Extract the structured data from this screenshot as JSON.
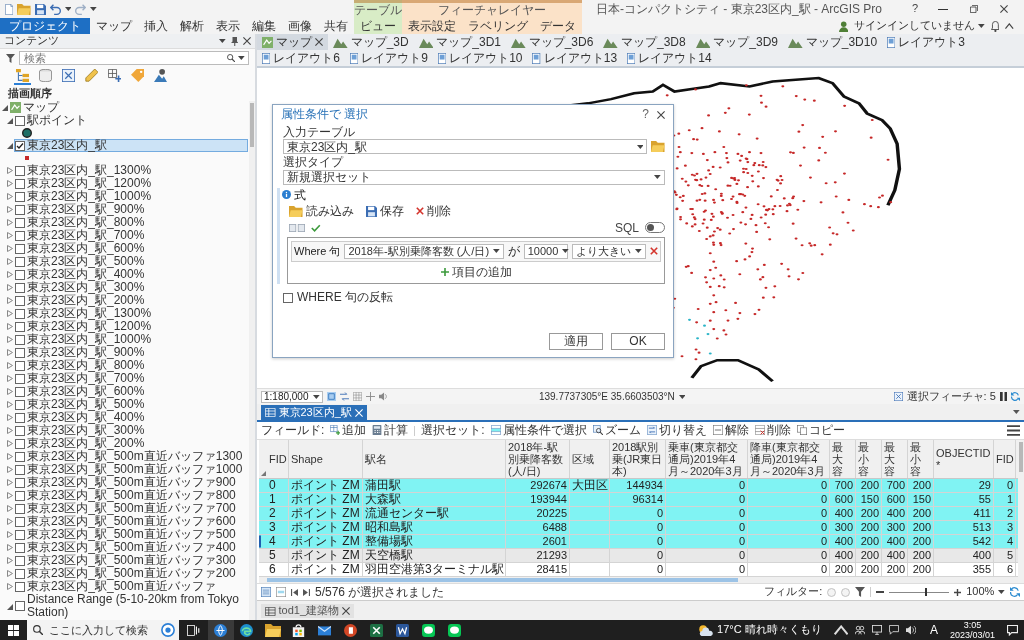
{
  "window": {
    "title": "日本-コンパクトシティ - 東京23区内_駅 - ArcGIS Pro",
    "help": "?"
  },
  "ribbon": {
    "tabs": [
      {
        "label": "プロジェクト",
        "kind": "backstage"
      },
      {
        "label": "マップ",
        "kind": "tab"
      },
      {
        "label": "挿入",
        "kind": "tab"
      },
      {
        "label": "解析",
        "kind": "tab"
      },
      {
        "label": "表示",
        "kind": "tab"
      },
      {
        "label": "編集",
        "kind": "tab"
      },
      {
        "label": "画像",
        "kind": "tab"
      },
      {
        "label": "共有",
        "kind": "tab"
      }
    ],
    "context_groups": [
      {
        "title": "テーブル",
        "color": "#d8ecc6",
        "tabs": [
          {
            "label": "ビュー"
          }
        ]
      },
      {
        "title": "フィーチャレイヤー",
        "color": "#fbe2c8",
        "tabs": [
          {
            "label": "表示設定"
          },
          {
            "label": "ラベリング"
          },
          {
            "label": "データ"
          }
        ]
      }
    ],
    "account": "サインインしていません"
  },
  "contents_pane": {
    "title": "コンテンツ",
    "search": {
      "placeholder": "検索"
    },
    "views": [
      {
        "kind": "drawing-order",
        "selected": true
      },
      {
        "kind": "source",
        "selected": false
      },
      {
        "kind": "selection",
        "selected": false
      },
      {
        "kind": "editing",
        "selected": false
      },
      {
        "kind": "snapping",
        "selected": false
      },
      {
        "kind": "labeling",
        "selected": false
      },
      {
        "kind": "imagery",
        "selected": false
      }
    ],
    "heading": "描画順序",
    "tree": [
      {
        "label": "マップ",
        "kind": "map",
        "expanded": true,
        "selected": false,
        "children": [
          {
            "label": "駅ポイント",
            "kind": "layer",
            "checked": false,
            "expanded": true,
            "selected": false,
            "children": [
              {
                "kind": "circle",
                "color": "#1f6f66"
              }
            ]
          },
          {
            "label": "東京23区内_駅",
            "kind": "layer",
            "checked": true,
            "expanded": true,
            "selected": true,
            "children": [
              {
                "kind": "dot",
                "color": "#c62828"
              }
            ]
          },
          {
            "label": "東京23区内_駅_1300%",
            "kind": "layer",
            "checked": false,
            "expanded": false,
            "selected": false
          },
          {
            "label": "東京23区内_駅_1200%",
            "kind": "layer",
            "checked": false,
            "expanded": false,
            "selected": false
          },
          {
            "label": "東京23区内_駅_1000%",
            "kind": "layer",
            "checked": false,
            "expanded": false,
            "selected": false
          },
          {
            "label": "東京23区内_駅_900%",
            "kind": "layer",
            "checked": false,
            "expanded": false,
            "selected": false
          },
          {
            "label": "東京23区内_駅_800%",
            "kind": "layer",
            "checked": false,
            "expanded": false,
            "selected": false
          },
          {
            "label": "東京23区内_駅_700%",
            "kind": "layer",
            "checked": false,
            "expanded": false,
            "selected": false
          },
          {
            "label": "東京23区内_駅_600%",
            "kind": "layer",
            "checked": false,
            "expanded": false,
            "selected": false
          },
          {
            "label": "東京23区内_駅_500%",
            "kind": "layer",
            "checked": false,
            "expanded": false,
            "selected": false
          },
          {
            "label": "東京23区内_駅_400%",
            "kind": "layer",
            "checked": false,
            "expanded": false,
            "selected": false
          },
          {
            "label": "東京23区内_駅_300%",
            "kind": "layer",
            "checked": false,
            "expanded": false,
            "selected": false
          },
          {
            "label": "東京23区内_駅_200%",
            "kind": "layer",
            "checked": false,
            "expanded": false,
            "selected": false
          },
          {
            "label": "東京23区内_駅_1300%",
            "kind": "layer",
            "checked": false,
            "expanded": false,
            "selected": false
          },
          {
            "label": "東京23区内_駅_1200%",
            "kind": "layer",
            "checked": false,
            "expanded": false,
            "selected": false
          },
          {
            "label": "東京23区内_駅_1000%",
            "kind": "layer",
            "checked": false,
            "expanded": false,
            "selected": false
          },
          {
            "label": "東京23区内_駅_900%",
            "kind": "layer",
            "checked": false,
            "expanded": false,
            "selected": false
          },
          {
            "label": "東京23区内_駅_800%",
            "kind": "layer",
            "checked": false,
            "expanded": false,
            "selected": false
          },
          {
            "label": "東京23区内_駅_700%",
            "kind": "layer",
            "checked": false,
            "expanded": false,
            "selected": false
          },
          {
            "label": "東京23区内_駅_600%",
            "kind": "layer",
            "checked": false,
            "expanded": false,
            "selected": false
          },
          {
            "label": "東京23区内_駅_500%",
            "kind": "layer",
            "checked": false,
            "expanded": false,
            "selected": false
          },
          {
            "label": "東京23区内_駅_400%",
            "kind": "layer",
            "checked": false,
            "expanded": false,
            "selected": false
          },
          {
            "label": "東京23区内_駅_300%",
            "kind": "layer",
            "checked": false,
            "expanded": false,
            "selected": false
          },
          {
            "label": "東京23区内_駅_200%",
            "kind": "layer",
            "checked": false,
            "expanded": false,
            "selected": false
          },
          {
            "label": "東京23区内_駅_500m直近バッファ1300",
            "kind": "layer",
            "checked": false,
            "expanded": false,
            "selected": false
          },
          {
            "label": "東京23区内_駅_500m直近バッファ1000",
            "kind": "layer",
            "checked": false,
            "expanded": false,
            "selected": false
          },
          {
            "label": "東京23区内_駅_500m直近バッファ900",
            "kind": "layer",
            "checked": false,
            "expanded": false,
            "selected": false
          },
          {
            "label": "東京23区内_駅_500m直近バッファ800",
            "kind": "layer",
            "checked": false,
            "expanded": false,
            "selected": false
          },
          {
            "label": "東京23区内_駅_500m直近バッファ700",
            "kind": "layer",
            "checked": false,
            "expanded": false,
            "selected": false
          },
          {
            "label": "東京23区内_駅_500m直近バッファ600",
            "kind": "layer",
            "checked": false,
            "expanded": false,
            "selected": false
          },
          {
            "label": "東京23区内_駅_500m直近バッファ500",
            "kind": "layer",
            "checked": false,
            "expanded": false,
            "selected": false
          },
          {
            "label": "東京23区内_駅_500m直近バッファ400",
            "kind": "layer",
            "checked": false,
            "expanded": false,
            "selected": false
          },
          {
            "label": "東京23区内_駅_500m直近バッファ300",
            "kind": "layer",
            "checked": false,
            "expanded": false,
            "selected": false
          },
          {
            "label": "東京23区内_駅_500m直近バッファ200",
            "kind": "layer",
            "checked": false,
            "expanded": false,
            "selected": false
          },
          {
            "label": "東京23区内_駅_500m直近バッファ",
            "kind": "layer",
            "checked": false,
            "expanded": false,
            "selected": false
          },
          {
            "label": "Distance Range (5-10-20km from Tokyo Station)",
            "kind": "layer",
            "checked": false,
            "expanded": true,
            "selected": false
          }
        ]
      }
    ]
  },
  "map_tabs": [
    {
      "label": "マップ",
      "kind": "map",
      "selected": true
    },
    {
      "label": "マップ_3D",
      "kind": "scene",
      "selected": false
    },
    {
      "label": "マップ_3D1",
      "kind": "scene",
      "selected": false
    },
    {
      "label": "マップ_3D6",
      "kind": "scene",
      "selected": false
    },
    {
      "label": "マップ_3D8",
      "kind": "scene",
      "selected": false
    },
    {
      "label": "マップ_3D9",
      "kind": "scene",
      "selected": false
    },
    {
      "label": "マップ_3D10",
      "kind": "scene",
      "selected": false
    },
    {
      "label": "レイアウト3",
      "kind": "layout",
      "selected": false
    },
    {
      "label": "レイアウト6",
      "kind": "layout",
      "selected": false
    },
    {
      "label": "レイアウト9",
      "kind": "layout",
      "selected": false
    },
    {
      "label": "レイアウト10",
      "kind": "layout",
      "selected": false
    },
    {
      "label": "レイアウト13",
      "kind": "layout",
      "selected": false
    },
    {
      "label": "レイアウト14",
      "kind": "layout",
      "selected": false
    }
  ],
  "dialog": {
    "title": "属性条件で 選択",
    "help": "?",
    "input_table": {
      "label": "入力テーブル",
      "value": "東京23区内_駅"
    },
    "selection_type": {
      "label": "選択タイプ",
      "value": "新規選択セット"
    },
    "expression": {
      "label": "式",
      "actions": [
        {
          "label": "読み込み",
          "kind": "open"
        },
        {
          "label": "保存",
          "kind": "save"
        },
        {
          "label": "削除",
          "kind": "delete"
        }
      ],
      "sql": {
        "label": "SQL",
        "on": false
      },
      "clause": {
        "prefix": "Where 句",
        "field": "2018年-駅別乗降客数 (人/日)",
        "connector": "が",
        "value": "10000",
        "operator": "より大きい"
      },
      "add_item": "項目の追加"
    },
    "invert": {
      "label": "WHERE 句の反転",
      "checked": false
    },
    "buttons": [
      "適用",
      "OK"
    ]
  },
  "map_status": {
    "scale": "1:180,000",
    "coordinates": "139.7737305°E 35.6603503°N",
    "selected_features": "選択フィーチャ: 5"
  },
  "table_view": {
    "tab": "東京23区内_駅",
    "toolbar": {
      "field_label": "フィールド:",
      "field_actions": [
        {
          "label": "追加",
          "kind": "add-field"
        },
        {
          "label": "計算",
          "kind": "calculate"
        }
      ],
      "selection_label": "選択セット:",
      "selection_actions": [
        {
          "label": "属性条件で選択",
          "kind": "select-by-attributes"
        },
        {
          "label": "ズーム",
          "kind": "zoom-to"
        },
        {
          "label": "切り替え",
          "kind": "switch"
        },
        {
          "label": "解除",
          "kind": "clear"
        },
        {
          "label": "削除",
          "kind": "delete-rows"
        },
        {
          "label": "コピー",
          "kind": "copy"
        }
      ]
    },
    "columns": [
      {
        "label": "FID",
        "kind": "text"
      },
      {
        "label": "Shape",
        "kind": "text"
      },
      {
        "label": "駅名",
        "kind": "text"
      },
      {
        "label": "2018年-駅別乗降客数 (人/日)",
        "kind": "number"
      },
      {
        "label": "区域",
        "kind": "text"
      },
      {
        "label": "2018駅別乗(JR東日本)",
        "kind": "number"
      },
      {
        "label": "乗車(東京都交通局)2019年4月～2020年3月",
        "kind": "number"
      },
      {
        "label": "降車(東京都交通局)2019年4月～2020年3月",
        "kind": "number"
      },
      {
        "label": "最大容",
        "kind": "number"
      },
      {
        "label": "最小容",
        "kind": "number"
      },
      {
        "label": "最大容",
        "kind": "number"
      },
      {
        "label": "最小容",
        "kind": "number"
      },
      {
        "label": "OBJECTID *",
        "kind": "number"
      },
      {
        "label": "FID",
        "kind": "number"
      }
    ],
    "rows": [
      {
        "selected": true,
        "current": false,
        "cells": [
          "0",
          "ポイント ZM",
          "蒲田駅",
          "292674",
          "大田区",
          "144934",
          "0",
          "0",
          "700",
          "200",
          "700",
          "200",
          "29",
          "0"
        ]
      },
      {
        "selected": true,
        "current": false,
        "cells": [
          "1",
          "ポイント ZM",
          "大森駅",
          "193944",
          null,
          "96314",
          "0",
          "0",
          "600",
          "150",
          "600",
          "150",
          "55",
          "1"
        ]
      },
      {
        "selected": true,
        "current": false,
        "cells": [
          "2",
          "ポイント ZM",
          "流通センター駅",
          "20225",
          null,
          "0",
          "0",
          "0",
          "400",
          "200",
          "400",
          "200",
          "411",
          "2"
        ]
      },
      {
        "selected": true,
        "current": false,
        "cells": [
          "3",
          "ポイント ZM",
          "昭和島駅",
          "6488",
          null,
          "0",
          "0",
          "0",
          "300",
          "200",
          "300",
          "200",
          "513",
          "3"
        ]
      },
      {
        "selected": true,
        "current": true,
        "cells": [
          "4",
          "ポイント ZM",
          "整備場駅",
          "2601",
          null,
          "0",
          "0",
          "0",
          "400",
          "200",
          "400",
          "200",
          "542",
          "4"
        ]
      },
      {
        "selected": false,
        "current": false,
        "cells": [
          "5",
          "ポイント ZM",
          "天空橋駅",
          "21293",
          null,
          "0",
          "0",
          "0",
          "400",
          "200",
          "400",
          "200",
          "400",
          "5"
        ]
      },
      {
        "selected": false,
        "current": false,
        "cells": [
          "6",
          "ポイント ZM",
          "羽田空港第3ターミナル駅",
          "28415",
          null,
          "0",
          "0",
          "0",
          "200",
          "200",
          "200",
          "200",
          "355",
          "6"
        ]
      }
    ],
    "selection_count": "5/576 が選択されました",
    "filter_label": "フィルター:",
    "zoom": {
      "level": 0.62,
      "reading": "100%"
    }
  },
  "second_table_tab": "tod1_建築物",
  "taskbar": {
    "search": {
      "placeholder": "ここに入力して検索"
    },
    "apps": [
      {
        "kind": "arcgis",
        "active": true
      },
      {
        "kind": "edge",
        "active": false
      },
      {
        "kind": "explorer",
        "active": false
      },
      {
        "kind": "store",
        "active": false
      },
      {
        "kind": "mail",
        "active": false
      },
      {
        "kind": "powerpoint",
        "active": false
      },
      {
        "kind": "excel",
        "active": false
      },
      {
        "kind": "word",
        "active": false
      },
      {
        "kind": "line",
        "active": false
      },
      {
        "kind": "line",
        "active": false
      }
    ],
    "weather": "17°C 晴れ時々くもり",
    "ime": "A",
    "time": "3:05",
    "date": "2023/03/01"
  }
}
